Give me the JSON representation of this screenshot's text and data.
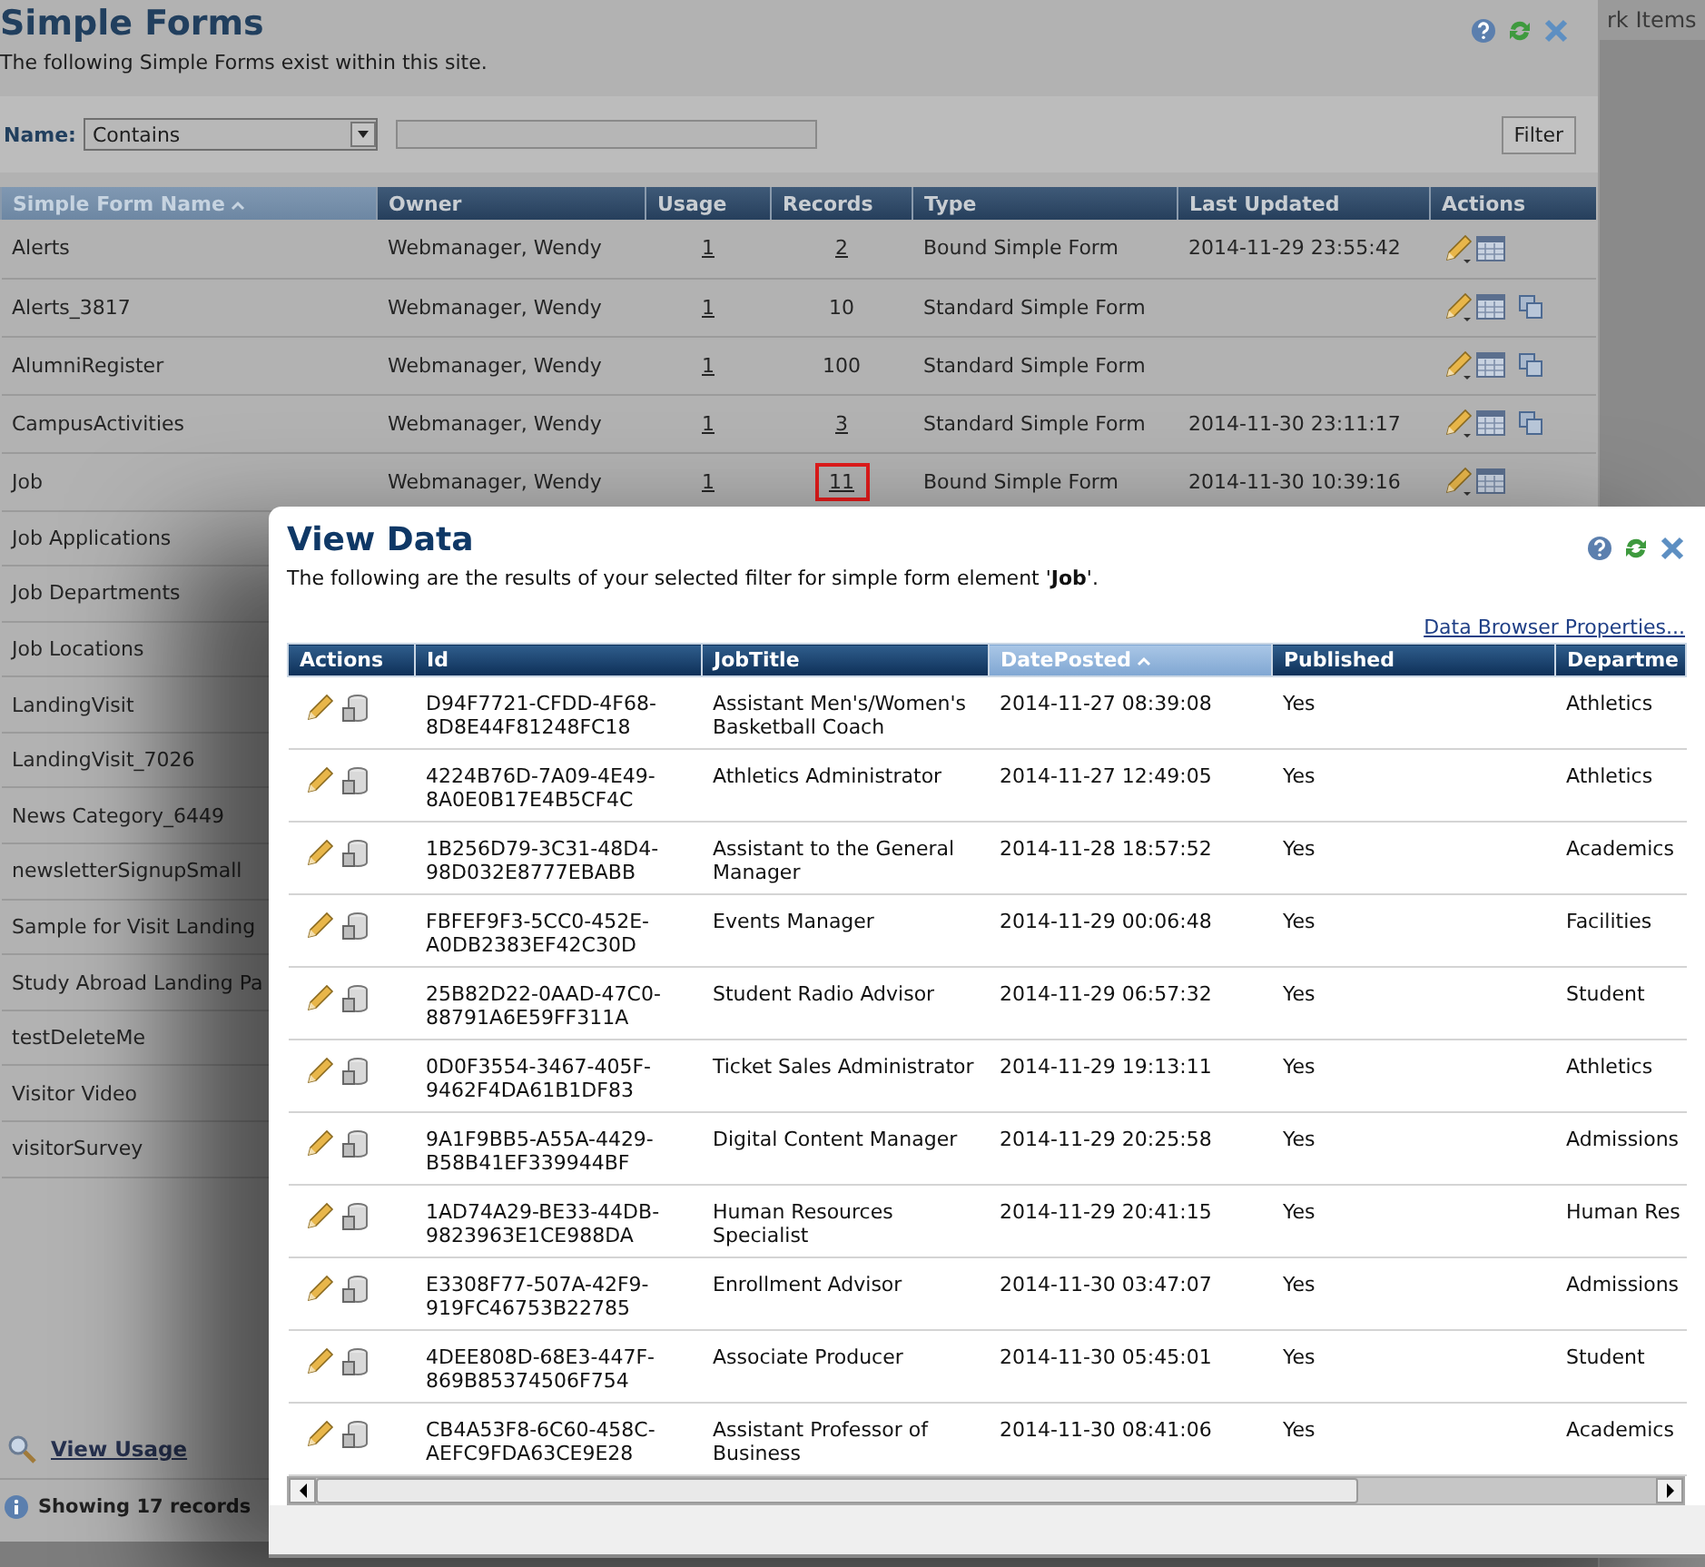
{
  "window": {
    "title": "Simple Forms",
    "subtitle": "The following Simple Forms exist within this site."
  },
  "side_tab": "rk Items",
  "filter": {
    "label": "Name:",
    "operator": "Contains",
    "button": "Filter"
  },
  "table": {
    "columns": [
      {
        "label": "Simple Form Name",
        "sorted": true
      },
      {
        "label": "Owner",
        "sorted": false
      },
      {
        "label": "Usage",
        "sorted": false
      },
      {
        "label": "Records",
        "sorted": false
      },
      {
        "label": "Type",
        "sorted": false
      },
      {
        "label": "Last Updated",
        "sorted": false
      },
      {
        "label": "Actions",
        "sorted": false
      }
    ],
    "rows": [
      {
        "name": "Alerts",
        "owner": "Webmanager, Wendy",
        "usage": "1",
        "records": "2",
        "records_link": true,
        "highlighted": false,
        "type": "Bound Simple Form",
        "last_updated": "2014-11-29 23:55:42",
        "copy_action": false
      },
      {
        "name": "Alerts_3817",
        "owner": "Webmanager, Wendy",
        "usage": "1",
        "records": "10",
        "records_link": false,
        "highlighted": false,
        "type": "Standard Simple Form",
        "copy_action": true
      },
      {
        "name": "AlumniRegister",
        "owner": "Webmanager, Wendy",
        "usage": "1",
        "records": "100",
        "records_link": false,
        "highlighted": false,
        "type": "Standard Simple Form",
        "copy_action": true
      },
      {
        "name": "CampusActivities",
        "owner": "Webmanager, Wendy",
        "usage": "1",
        "records": "3",
        "records_link": true,
        "highlighted": false,
        "type": "Standard Simple Form",
        "last_updated": "2014-11-30 23:11:17",
        "copy_action": true
      },
      {
        "name": "Job",
        "owner": "Webmanager, Wendy",
        "usage": "1",
        "records": "11",
        "records_link": true,
        "highlighted": true,
        "type": "Bound Simple Form",
        "last_updated": "2014-11-30 10:39:16",
        "copy_action": false
      },
      {
        "name": "Job Applications"
      },
      {
        "name": "Job Departments"
      },
      {
        "name": "Job Locations"
      },
      {
        "name": "LandingVisit"
      },
      {
        "name": "LandingVisit_7026"
      },
      {
        "name": "News Category_6449"
      },
      {
        "name": "newsletterSignupSmall"
      },
      {
        "name": "Sample for Visit Landing"
      },
      {
        "name": "Study Abroad Landing Pa"
      },
      {
        "name": "testDeleteMe"
      },
      {
        "name": "Visitor Video"
      },
      {
        "name": "visitorSurvey"
      }
    ]
  },
  "footer": {
    "link": "View Usage",
    "status": "Showing 17 records"
  },
  "dialog": {
    "title": "View Data",
    "description": "The following are the results of your selected filter for simple form element '**Job**'.",
    "link": "Data Browser Properties...",
    "columns": [
      {
        "label": "Actions",
        "sorted": false
      },
      {
        "label": "Id",
        "sorted": false
      },
      {
        "label": "JobTitle",
        "sorted": false
      },
      {
        "label": "DatePosted",
        "sorted": true
      },
      {
        "label": "Published",
        "sorted": false
      },
      {
        "label": "Departme",
        "sorted": false
      }
    ],
    "rows": [
      {
        "id": "D94F7721-CFDD-4F68-8D8E44F81248FC18",
        "job_title": "Assistant Men's/Women's Basketball Coach",
        "date_posted": "2014-11-27 08:39:08",
        "published": "Yes",
        "department": "Athletics"
      },
      {
        "id": "4224B76D-7A09-4E49-8A0E0B17E4B5CF4C",
        "job_title": "Athletics Administrator",
        "date_posted": "2014-11-27 12:49:05",
        "published": "Yes",
        "department": "Athletics"
      },
      {
        "id": "1B256D79-3C31-48D4-98D032E8777EBABB",
        "job_title": "Assistant to the General Manager",
        "date_posted": "2014-11-28 18:57:52",
        "published": "Yes",
        "department": "Academics"
      },
      {
        "id": "FBFEF9F3-5CC0-452E-A0DB2383EF42C30D",
        "job_title": "Events Manager",
        "date_posted": "2014-11-29 00:06:48",
        "published": "Yes",
        "department": "Facilities"
      },
      {
        "id": "25B82D22-0AAD-47C0-88791A6E59FF311A",
        "job_title": "Student Radio Advisor",
        "date_posted": "2014-11-29 06:57:32",
        "published": "Yes",
        "department": "Student"
      },
      {
        "id": "0D0F3554-3467-405F-9462F4DA61B1DF83",
        "job_title": "Ticket Sales Administrator",
        "date_posted": "2014-11-29 19:13:11",
        "published": "Yes",
        "department": "Athletics"
      },
      {
        "id": "9A1F9BB5-A55A-4429-B58B41EF339944BF",
        "job_title": "Digital Content Manager",
        "date_posted": "2014-11-29 20:25:58",
        "published": "Yes",
        "department": "Admissions"
      },
      {
        "id": "1AD74A29-BE33-44DB-9823963E1CE988DA",
        "job_title": "Human Resources Specialist",
        "date_posted": "2014-11-29 20:41:15",
        "published": "Yes",
        "department": "Human Res"
      },
      {
        "id": "E3308F77-507A-42F9-919FC46753B22785",
        "job_title": "Enrollment Advisor",
        "date_posted": "2014-11-30 03:47:07",
        "published": "Yes",
        "department": "Admissions"
      },
      {
        "id": "4DEE808D-68E3-447F-869B85374506F754",
        "job_title": "Associate Producer",
        "date_posted": "2014-11-30 05:45:01",
        "published": "Yes",
        "department": "Student"
      },
      {
        "id": "CB4A53F8-6C60-458C-AEFC9FDA63CE9E28",
        "job_title": "Assistant Professor of Business",
        "date_posted": "2014-11-30 08:41:06",
        "published": "Yes",
        "department": "Academics"
      }
    ]
  }
}
